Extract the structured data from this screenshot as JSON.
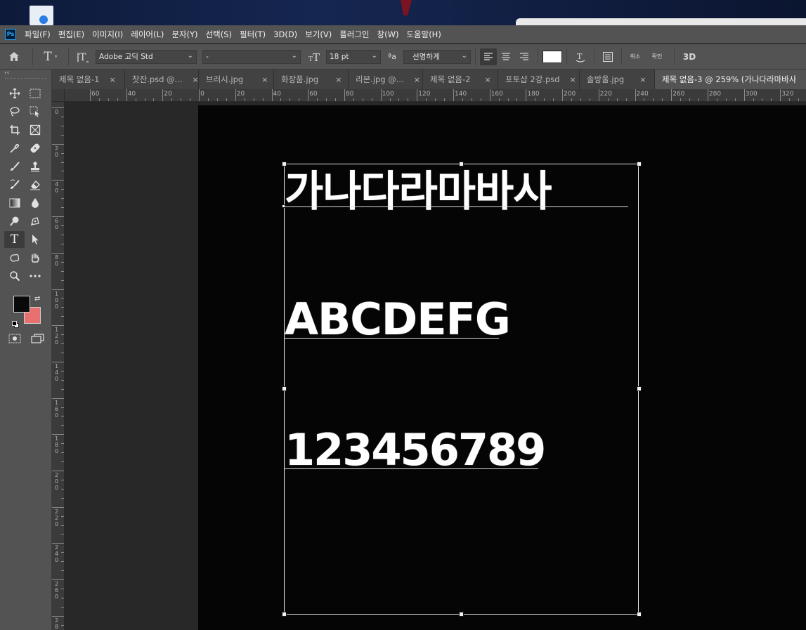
{
  "menu": {
    "app_icon": "Ps",
    "items": [
      "파일(F)",
      "편집(E)",
      "이미지(I)",
      "레이어(L)",
      "문자(Y)",
      "선택(S)",
      "필터(T)",
      "3D(D)",
      "보기(V)",
      "플러그인",
      "창(W)",
      "도움말(H)"
    ]
  },
  "options": {
    "font_family": "Adobe 고딕 Std",
    "font_style": "-",
    "font_size": "18 pt",
    "aa_label": "ªa",
    "antialias": "선명하게",
    "cancel": "취소",
    "commit": "확인",
    "threed": "3D",
    "text_color": "#ffffff"
  },
  "tabs": [
    {
      "label": "제목 없음-1",
      "close": "×"
    },
    {
      "label": "찻잔.psd @...",
      "close": "×"
    },
    {
      "label": "브러시.jpg",
      "close": "×"
    },
    {
      "label": "화장품.jpg",
      "close": "×"
    },
    {
      "label": "리본.jpg @...",
      "close": "×"
    },
    {
      "label": "제목 없음-2",
      "close": "×"
    },
    {
      "label": "포토샵 2강.psd",
      "close": "×"
    },
    {
      "label": "솔방울.jpg",
      "close": "×"
    },
    {
      "label": "제목 없음-3 @ 259% (가나다라마바사",
      "close": ""
    }
  ],
  "ruler_h_labels": [
    "60",
    "40",
    "20",
    "0",
    "20",
    "40",
    "60",
    "80",
    "100",
    "120",
    "140",
    "160",
    "180",
    "200",
    "220",
    "240",
    "260",
    "280",
    "300",
    "320"
  ],
  "ruler_v_labels": [
    "0",
    "2 0",
    "4 0",
    "6 0",
    "8 0",
    "1 0 0",
    "1 2 0",
    "1 4 0",
    "1 6 0",
    "1 8 0",
    "2 0 0",
    "2 2 0",
    "2 4 0",
    "2 6 0",
    "2 8"
  ],
  "canvas": {
    "line1": "가나다라마바사",
    "line2": "ABCDEFG",
    "line3": "123456789"
  },
  "colors": {
    "foreground": "#0a0a0a",
    "background": "#e8706f"
  }
}
